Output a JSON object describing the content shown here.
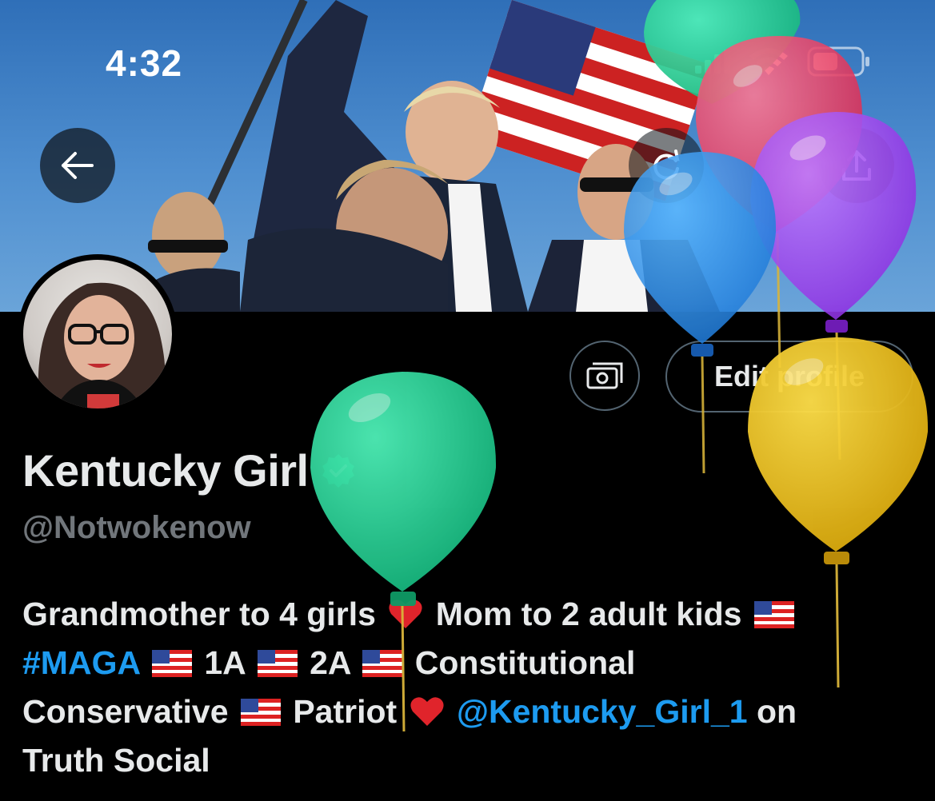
{
  "status_bar": {
    "time": "4:32"
  },
  "profile": {
    "display_name": "Kentucky Girl",
    "handle": "@Notwokenow",
    "edit_profile_label": "Edit profile"
  },
  "bio": {
    "line1": {
      "a": "Grandmother to 4 girls",
      "b": "Mom to 2 adult kids"
    },
    "line2": {
      "hashtag": "#MAGA",
      "a": "1A",
      "b": "2A",
      "c": "Constitutional"
    },
    "line3": {
      "a": "Conservative",
      "b": "Patriot",
      "mention": "@Kentucky_Girl_1",
      "c": "on"
    },
    "line4": "Truth Social"
  },
  "icons": {
    "back": "back-arrow-icon",
    "refresh": "refresh-icon",
    "share": "share-icon",
    "tip": "money-icon",
    "verified": "verified-badge-icon"
  },
  "colors": {
    "link": "#1d9bf0",
    "verified": "#00ba7c",
    "muted": "#71767b"
  }
}
